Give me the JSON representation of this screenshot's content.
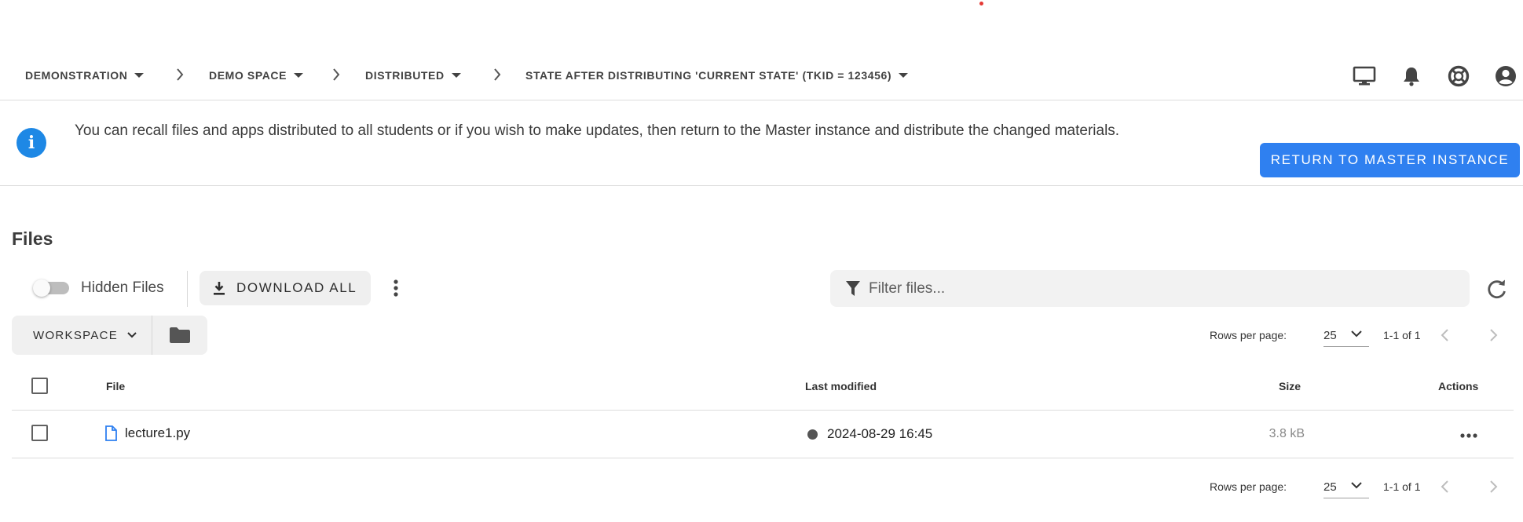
{
  "breadcrumbs": [
    {
      "label": "DEMONSTRATION"
    },
    {
      "label": "DEMO SPACE"
    },
    {
      "label": "DISTRIBUTED"
    },
    {
      "label": "STATE AFTER DISTRIBUTING 'CURRENT STATE' (TKID = 123456)"
    }
  ],
  "top_icons": [
    "monitor-icon",
    "bell-icon",
    "lifebuoy-icon",
    "account-circle-icon"
  ],
  "banner": {
    "text": "You can recall files and apps distributed to all students or if you wish to make updates, then return to the Master instance and distribute the changed materials.",
    "button_label": "RETURN TO MASTER INSTANCE",
    "icon": "info-icon",
    "accent": "#1e88e5"
  },
  "files": {
    "title": "Files",
    "hidden_files_label": "Hidden Files",
    "hidden_files_on": false,
    "download_all_label": "DOWNLOAD ALL",
    "filter_placeholder": "Filter files...",
    "workspace_label": "WORKSPACE"
  },
  "pagination": {
    "rows_per_page_label": "Rows per page:",
    "rows_per_page": "25",
    "range": "1-1 of 1"
  },
  "table": {
    "columns": {
      "file": "File",
      "last_modified": "Last modified",
      "size": "Size",
      "actions": "Actions"
    },
    "rows": [
      {
        "name": "lecture1.py",
        "modified": "2024-08-29 16:45",
        "size": "3.8 kB"
      }
    ]
  },
  "colors": {
    "primary_button": "#2f80f0",
    "file_icon": "#2f80f0"
  }
}
